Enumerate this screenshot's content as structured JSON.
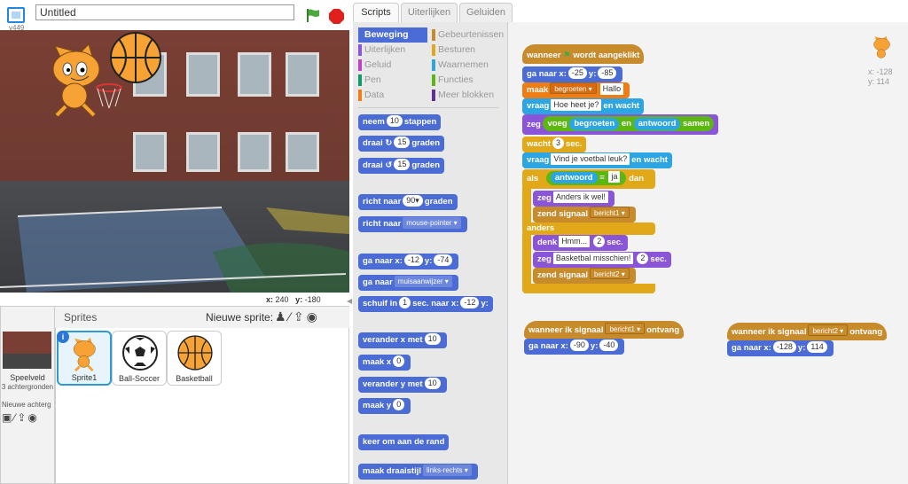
{
  "header": {
    "version": "v449",
    "project_title": "Untitled",
    "flag_icon": "green-flag-icon",
    "stop_icon": "stop-sign-icon"
  },
  "stage": {
    "coords": {
      "x_label": "x:",
      "x_value": "240",
      "y_label": "y:",
      "y_value": "-180"
    }
  },
  "sprites_pane": {
    "title": "Sprites",
    "new_sprite_label": "Nieuwe sprite:",
    "stage_label": "Speelveld",
    "stage_sub": "3 achtergronden",
    "new_backdrop_label": "Nieuwe achterg",
    "sprites": [
      {
        "name": "Sprite1",
        "selected": true
      },
      {
        "name": "Ball-Soccer",
        "selected": false
      },
      {
        "name": "Basketball",
        "selected": false
      }
    ]
  },
  "tabs": [
    "Scripts",
    "Uiterlijken",
    "Geluiden"
  ],
  "categories_left": [
    {
      "label": "Beweging",
      "color": "#4a6cd4",
      "active": true
    },
    {
      "label": "Uiterlijken",
      "color": "#8a55d7"
    },
    {
      "label": "Geluid",
      "color": "#bb42c3"
    },
    {
      "label": "Pen",
      "color": "#0e9a6c"
    },
    {
      "label": "Data",
      "color": "#ee7d16"
    }
  ],
  "categories_right": [
    {
      "label": "Gebeurtenissen",
      "color": "#c88b2b"
    },
    {
      "label": "Besturen",
      "color": "#e1a91a"
    },
    {
      "label": "Waarnemen",
      "color": "#2ca5e2"
    },
    {
      "label": "Functies",
      "color": "#5cb712"
    },
    {
      "label": "Meer blokken",
      "color": "#632d99"
    }
  ],
  "palette": {
    "move": {
      "a": "neem",
      "n": "10",
      "b": "stappen"
    },
    "turn_right": {
      "a": "draai",
      "n": "15",
      "b": "graden"
    },
    "turn_left": {
      "a": "draai",
      "n": "15",
      "b": "graden"
    },
    "point_dir": {
      "a": "richt naar",
      "d": "90▾",
      "b": "graden"
    },
    "point_to": {
      "a": "richt naar",
      "d": "mouse-pointer ▾"
    },
    "goto_xy": {
      "a": "ga naar x:",
      "x": "-12",
      "y_label": "y:",
      "y": "-74"
    },
    "goto": {
      "a": "ga naar",
      "d": "muisaanwijzer ▾"
    },
    "glide": {
      "a": "schuif in",
      "n": "1",
      "b": "sec. naar x:",
      "x": "-12",
      "y_label": "y:"
    },
    "change_x": {
      "a": "verander x met",
      "n": "10"
    },
    "set_x": {
      "a": "maak x",
      "n": "0"
    },
    "change_y": {
      "a": "verander y met",
      "n": "10"
    },
    "set_y": {
      "a": "maak y",
      "n": "0"
    },
    "bounce": {
      "a": "keer om aan de rand"
    },
    "rotation_style": {
      "a": "maak draaistijl",
      "d": "links-rechts ▾"
    }
  },
  "script1": {
    "hat": {
      "a": "wanneer",
      "b": "wordt aangeklikt"
    },
    "goto": {
      "a": "ga naar x:",
      "x": "-25",
      "y_label": "y:",
      "y": "-85"
    },
    "setvar": {
      "a": "maak",
      "d": "begroeten ▾",
      "v": "Hallo"
    },
    "ask1": {
      "a": "vraag",
      "s": "Hoe heet je?",
      "b": "en wacht"
    },
    "say_join": {
      "a": "zeg",
      "op": "voeg",
      "v1": "begroeten",
      "mid": "en",
      "v2": "antwoord",
      "end": "samen"
    },
    "wait": {
      "a": "wacht",
      "n": "3",
      "b": "sec."
    },
    "ask2": {
      "a": "vraag",
      "s": "Vind je voetbal leuk?",
      "b": "en wacht"
    },
    "if": {
      "a": "als",
      "v": "antwoord",
      "eq": "=",
      "s": "ja",
      "b": "dan"
    },
    "say1": {
      "a": "zeg",
      "s": "Anders ik wel!"
    },
    "broadcast1": {
      "a": "zend signaal",
      "d": "bericht1 ▾"
    },
    "else": "anders",
    "think": {
      "a": "denk",
      "s": "Hmm...",
      "n": "2",
      "b": "sec."
    },
    "say2": {
      "a": "zeg",
      "s": "Basketbal misschien!",
      "n": "2",
      "b": "sec."
    },
    "broadcast2": {
      "a": "zend signaal",
      "d": "bericht2 ▾"
    }
  },
  "script2": {
    "hat": {
      "a": "wanneer ik signaal",
      "d": "bericht1 ▾",
      "b": "ontvang"
    },
    "goto": {
      "a": "ga naar x:",
      "x": "-90",
      "y_label": "y:",
      "y": "-40"
    }
  },
  "script3": {
    "hat": {
      "a": "wanneer ik signaal",
      "d": "bericht2 ▾",
      "b": "ontvang"
    },
    "goto": {
      "a": "ga naar x:",
      "x": "-128",
      "y_label": "y:",
      "y": "114"
    }
  },
  "script_sprite_coords": {
    "x_label": "x:",
    "x": "-128",
    "y_label": "y:",
    "y": "114"
  }
}
